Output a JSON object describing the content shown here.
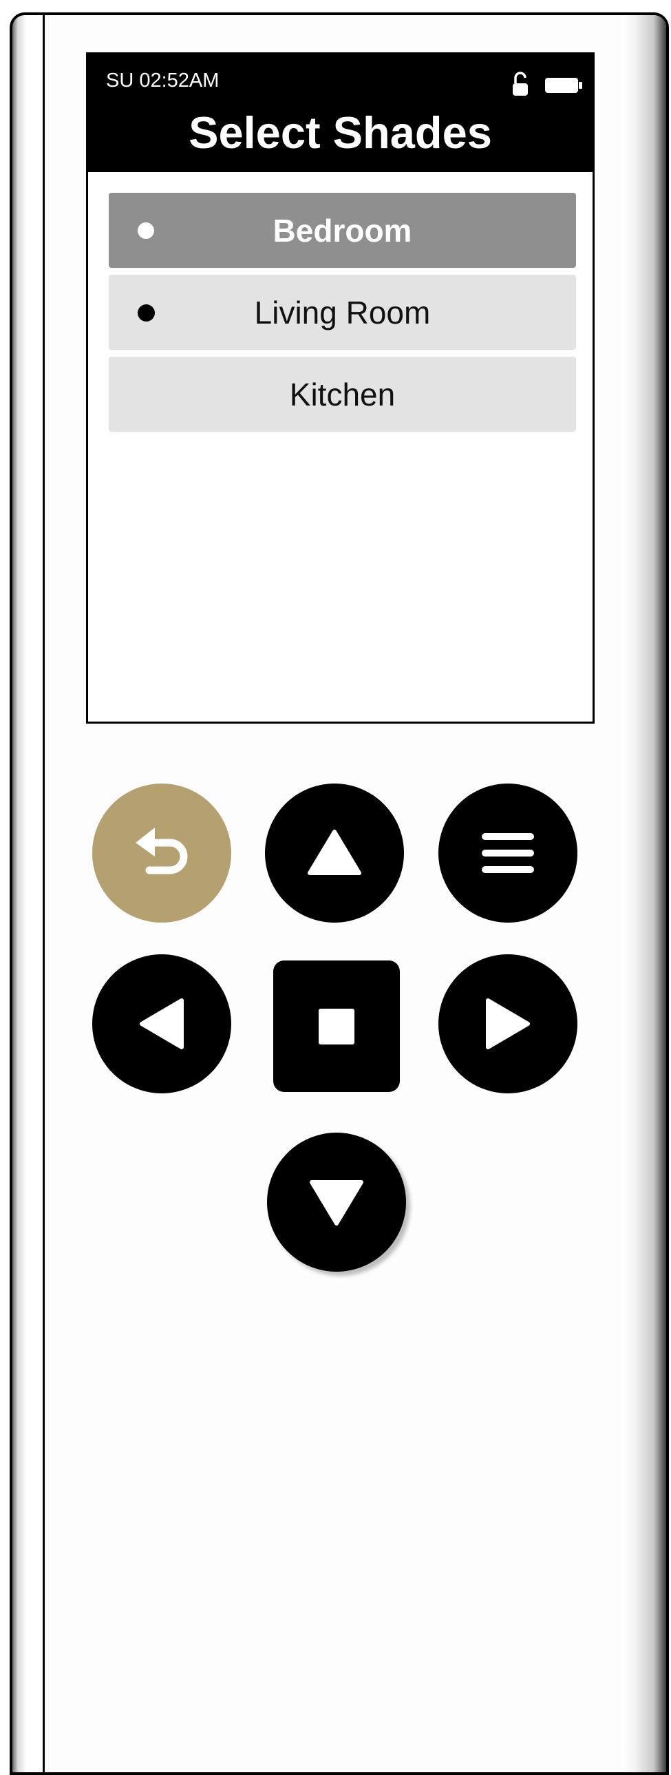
{
  "status": {
    "time": "SU 02:52AM",
    "lock_icon": "unlocked-padlock-icon",
    "battery_icon": "battery-full-icon"
  },
  "screen": {
    "title": "Select Shades",
    "items": [
      {
        "label": "Bedroom",
        "selected": true,
        "dot": true
      },
      {
        "label": "Living Room",
        "selected": false,
        "dot": true
      },
      {
        "label": "Kitchen",
        "selected": false,
        "dot": false
      }
    ]
  },
  "buttons": {
    "back": {
      "icon": "back-return-arrow-icon",
      "color": "#b5a06f"
    },
    "up": {
      "icon": "triangle-up-icon"
    },
    "menu": {
      "icon": "menu-hamburger-icon"
    },
    "left": {
      "icon": "triangle-left-icon"
    },
    "stop": {
      "icon": "square-stop-icon"
    },
    "right": {
      "icon": "triangle-right-icon"
    },
    "down": {
      "icon": "triangle-down-icon"
    }
  },
  "colors": {
    "selected_item": "#8f8f8f",
    "unselected_item": "#e3e3e3",
    "header": "#000000",
    "accent": "#b5a06f"
  }
}
